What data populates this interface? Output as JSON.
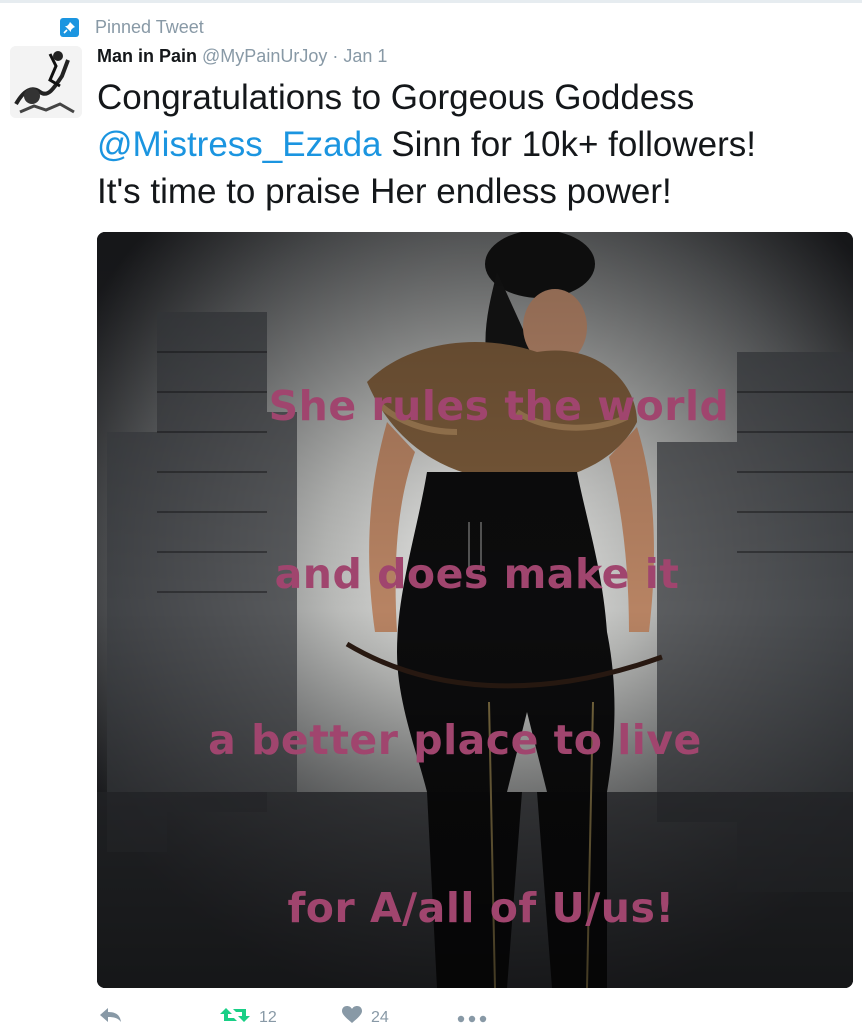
{
  "pinned": {
    "label": "Pinned Tweet",
    "icon": "pin-icon"
  },
  "tweet": {
    "author_name": "Man in Pain",
    "author_handle": "@MyPainUrJoy",
    "separator": "·",
    "date": "Jan 1",
    "text_line1": "Congratulations to Gorgeous Goddess",
    "mention": "@Mistress_Ezada",
    "text_line2_rest": " Sinn for 10k+ followers!",
    "text_line3": "It's time to praise Her endless power!"
  },
  "media": {
    "overlay_lines": [
      "She rules the world",
      "and does make it",
      "a better place to live",
      "for A/all of U/us!"
    ],
    "overlay_color": "#a0456e"
  },
  "actions": {
    "reply_icon": "reply-icon",
    "retweet_icon": "retweet-icon",
    "retweet_count": "12",
    "like_icon": "heart-icon",
    "like_count": "24",
    "more_icon": "more-icon"
  },
  "colors": {
    "link": "#1b95e0",
    "muted": "#8899a6",
    "text": "#14171a",
    "retweet_green": "#19cf86"
  }
}
